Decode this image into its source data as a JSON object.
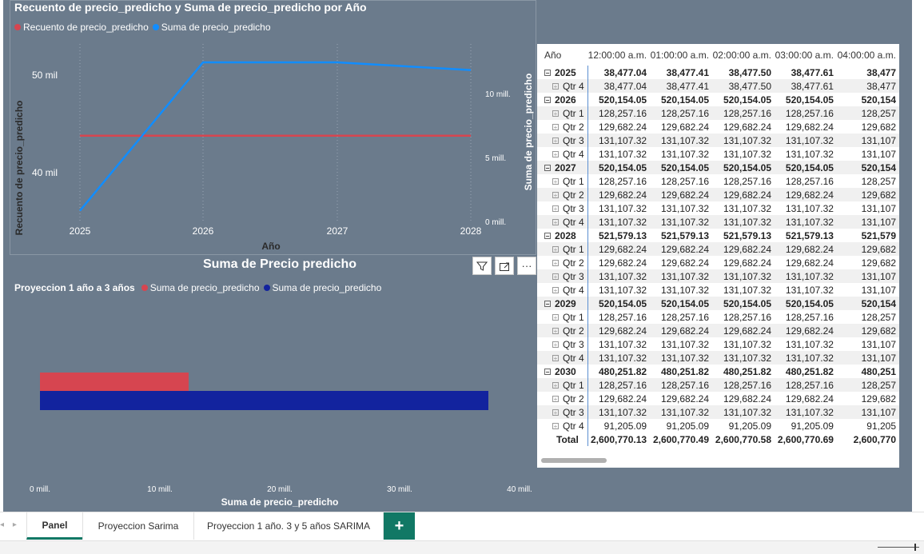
{
  "line_chart": {
    "title": "Recuento de precio_predicho y Suma de precio_predicho por Año",
    "legend": [
      {
        "label": "Recuento de precio_predicho",
        "color": "#d64550"
      },
      {
        "label": "Suma de precio_predicho",
        "color": "#118dff"
      }
    ],
    "y_left_label": "Recuento de precio_predicho",
    "y_right_label": "Suma de precio_predicho",
    "x_label": "Año",
    "y_left_ticks": [
      "50 mil",
      "40 mil"
    ],
    "y_right_ticks": [
      "10 mill.",
      "5 mill.",
      "0 mill."
    ],
    "x_ticks": [
      "2025",
      "2026",
      "2027",
      "2028"
    ]
  },
  "bar_chart": {
    "title": "Suma de Precio predicho",
    "legend_title": "Proyeccion 1 año a 3 años",
    "legend": [
      {
        "label": "Suma de precio_predicho",
        "color": "#d64550"
      },
      {
        "label": "Suma de precio_predicho",
        "color": "#12239e"
      }
    ],
    "x_label": "Suma de precio_predicho",
    "x_ticks": [
      "0 mill.",
      "10 mill.",
      "20 mill.",
      "30 mill.",
      "40 mill."
    ]
  },
  "chart_data": [
    {
      "type": "line",
      "title": "Recuento de precio_predicho y Suma de precio_predicho por Año",
      "x": [
        "2025",
        "2026",
        "2027",
        "2028"
      ],
      "xlabel": "Año",
      "series": [
        {
          "name": "Recuento de precio_predicho",
          "axis": "left",
          "color": "#d64550",
          "values": [
            43800,
            43800,
            43800,
            43800
          ]
        },
        {
          "name": "Suma de precio_predicho",
          "axis": "right",
          "color": "#118dff",
          "values": [
            900000,
            12500000,
            12500000,
            11900000
          ]
        }
      ],
      "ylabel_left": "Recuento de precio_predicho",
      "ylim_left": [
        36000,
        54000
      ],
      "ylabel_right": "Suma de precio_predicho",
      "ylim_right": [
        0,
        14000000
      ],
      "grid": "vertical dotted",
      "legend_position": "top-left"
    },
    {
      "type": "bar",
      "orientation": "horizontal",
      "title": "Suma de Precio predicho",
      "xlabel": "Suma de precio_predicho",
      "xlim": [
        0,
        40000000
      ],
      "series": [
        {
          "name": "Suma de precio_predicho",
          "color": "#d64550",
          "values": [
            12400000
          ]
        },
        {
          "name": "Suma de precio_predicho",
          "color": "#12239e",
          "values": [
            37400000
          ]
        }
      ],
      "legend_position": "top-left"
    }
  ],
  "matrix": {
    "corner_header": "Año",
    "columns": [
      "12:00:00 a.m.",
      "01:00:00 a.m.",
      "02:00:00 a.m.",
      "03:00:00 a.m.",
      "04:00:00 a.m."
    ],
    "rows": [
      {
        "type": "year",
        "label": "2025",
        "values": [
          "38,477.04",
          "38,477.41",
          "38,477.50",
          "38,477.61",
          "38,477"
        ]
      },
      {
        "type": "qtr",
        "label": "Qtr 4",
        "values": [
          "38,477.04",
          "38,477.41",
          "38,477.50",
          "38,477.61",
          "38,477"
        ]
      },
      {
        "type": "year",
        "label": "2026",
        "values": [
          "520,154.05",
          "520,154.05",
          "520,154.05",
          "520,154.05",
          "520,154"
        ]
      },
      {
        "type": "qtr",
        "label": "Qtr 1",
        "values": [
          "128,257.16",
          "128,257.16",
          "128,257.16",
          "128,257.16",
          "128,257"
        ]
      },
      {
        "type": "qtr",
        "label": "Qtr 2",
        "values": [
          "129,682.24",
          "129,682.24",
          "129,682.24",
          "129,682.24",
          "129,682"
        ]
      },
      {
        "type": "qtr",
        "label": "Qtr 3",
        "values": [
          "131,107.32",
          "131,107.32",
          "131,107.32",
          "131,107.32",
          "131,107"
        ]
      },
      {
        "type": "qtr",
        "label": "Qtr 4",
        "values": [
          "131,107.32",
          "131,107.32",
          "131,107.32",
          "131,107.32",
          "131,107"
        ]
      },
      {
        "type": "year",
        "label": "2027",
        "values": [
          "520,154.05",
          "520,154.05",
          "520,154.05",
          "520,154.05",
          "520,154"
        ]
      },
      {
        "type": "qtr",
        "label": "Qtr 1",
        "values": [
          "128,257.16",
          "128,257.16",
          "128,257.16",
          "128,257.16",
          "128,257"
        ]
      },
      {
        "type": "qtr",
        "label": "Qtr 2",
        "values": [
          "129,682.24",
          "129,682.24",
          "129,682.24",
          "129,682.24",
          "129,682"
        ]
      },
      {
        "type": "qtr",
        "label": "Qtr 3",
        "values": [
          "131,107.32",
          "131,107.32",
          "131,107.32",
          "131,107.32",
          "131,107"
        ]
      },
      {
        "type": "qtr",
        "label": "Qtr 4",
        "values": [
          "131,107.32",
          "131,107.32",
          "131,107.32",
          "131,107.32",
          "131,107"
        ]
      },
      {
        "type": "year",
        "label": "2028",
        "values": [
          "521,579.13",
          "521,579.13",
          "521,579.13",
          "521,579.13",
          "521,579"
        ]
      },
      {
        "type": "qtr",
        "label": "Qtr 1",
        "values": [
          "129,682.24",
          "129,682.24",
          "129,682.24",
          "129,682.24",
          "129,682"
        ]
      },
      {
        "type": "qtr",
        "label": "Qtr 2",
        "values": [
          "129,682.24",
          "129,682.24",
          "129,682.24",
          "129,682.24",
          "129,682"
        ]
      },
      {
        "type": "qtr",
        "label": "Qtr 3",
        "values": [
          "131,107.32",
          "131,107.32",
          "131,107.32",
          "131,107.32",
          "131,107"
        ]
      },
      {
        "type": "qtr",
        "label": "Qtr 4",
        "values": [
          "131,107.32",
          "131,107.32",
          "131,107.32",
          "131,107.32",
          "131,107"
        ]
      },
      {
        "type": "year",
        "label": "2029",
        "values": [
          "520,154.05",
          "520,154.05",
          "520,154.05",
          "520,154.05",
          "520,154"
        ]
      },
      {
        "type": "qtr",
        "label": "Qtr 1",
        "values": [
          "128,257.16",
          "128,257.16",
          "128,257.16",
          "128,257.16",
          "128,257"
        ]
      },
      {
        "type": "qtr",
        "label": "Qtr 2",
        "values": [
          "129,682.24",
          "129,682.24",
          "129,682.24",
          "129,682.24",
          "129,682"
        ]
      },
      {
        "type": "qtr",
        "label": "Qtr 3",
        "values": [
          "131,107.32",
          "131,107.32",
          "131,107.32",
          "131,107.32",
          "131,107"
        ]
      },
      {
        "type": "qtr",
        "label": "Qtr 4",
        "values": [
          "131,107.32",
          "131,107.32",
          "131,107.32",
          "131,107.32",
          "131,107"
        ]
      },
      {
        "type": "year",
        "label": "2030",
        "values": [
          "480,251.82",
          "480,251.82",
          "480,251.82",
          "480,251.82",
          "480,251"
        ]
      },
      {
        "type": "qtr",
        "label": "Qtr 1",
        "values": [
          "128,257.16",
          "128,257.16",
          "128,257.16",
          "128,257.16",
          "128,257"
        ]
      },
      {
        "type": "qtr",
        "label": "Qtr 2",
        "values": [
          "129,682.24",
          "129,682.24",
          "129,682.24",
          "129,682.24",
          "129,682"
        ]
      },
      {
        "type": "qtr",
        "label": "Qtr 3",
        "values": [
          "131,107.32",
          "131,107.32",
          "131,107.32",
          "131,107.32",
          "131,107"
        ]
      },
      {
        "type": "qtr",
        "label": "Qtr 4",
        "values": [
          "91,205.09",
          "91,205.09",
          "91,205.09",
          "91,205.09",
          "91,205"
        ]
      },
      {
        "type": "total",
        "label": "Total",
        "values": [
          "2,600,770.13",
          "2,600,770.49",
          "2,600,770.58",
          "2,600,770.69",
          "2,600,770"
        ]
      }
    ]
  },
  "visual_header": {
    "icons": [
      "filter-icon",
      "focus-mode-icon",
      "more-options-icon"
    ],
    "more_label": "···"
  },
  "tabs": {
    "items": [
      {
        "label": "Panel",
        "active": true
      },
      {
        "label": "Proyeccion Sarima",
        "active": false
      },
      {
        "label": "Proyeccion 1 año. 3 y 5 años SARIMA",
        "active": false
      }
    ],
    "add_label": "+"
  },
  "colors": {
    "canvas": "#6b7b8c",
    "accent": "#117865"
  }
}
